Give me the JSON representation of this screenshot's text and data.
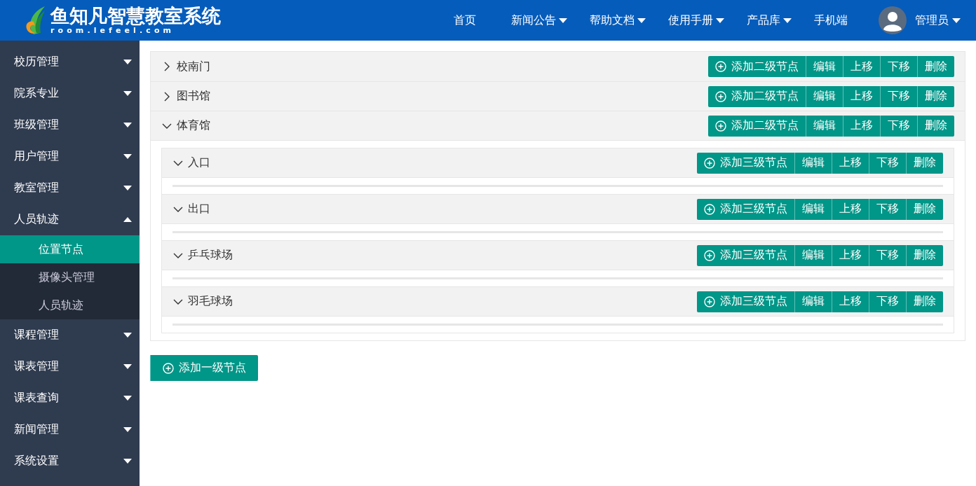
{
  "header": {
    "logo_title": "鱼知凡智慧教室系统",
    "logo_subtitle": "room.lefeel.com",
    "nav": [
      {
        "label": "首页",
        "has_menu": false
      },
      {
        "label": "新闻公告",
        "has_menu": true
      },
      {
        "label": "帮助文档",
        "has_menu": true
      },
      {
        "label": "使用手册",
        "has_menu": true
      },
      {
        "label": "产品库",
        "has_menu": true
      },
      {
        "label": "手机端",
        "has_menu": false
      }
    ],
    "user": {
      "name": "管理员",
      "has_menu": true
    }
  },
  "sidebar": {
    "items": [
      {
        "label": "校历管理",
        "expanded": false
      },
      {
        "label": "院系专业",
        "expanded": false
      },
      {
        "label": "班级管理",
        "expanded": false
      },
      {
        "label": "用户管理",
        "expanded": false
      },
      {
        "label": "教室管理",
        "expanded": false
      },
      {
        "label": "人员轨迹",
        "expanded": true,
        "children": [
          {
            "label": "位置节点",
            "selected": true
          },
          {
            "label": "摄像头管理",
            "selected": false
          },
          {
            "label": "人员轨迹",
            "selected": false
          }
        ]
      },
      {
        "label": "课程管理",
        "expanded": false
      },
      {
        "label": "课表管理",
        "expanded": false
      },
      {
        "label": "课表查询",
        "expanded": false
      },
      {
        "label": "新闻管理",
        "expanded": false
      },
      {
        "label": "系统设置",
        "expanded": false
      }
    ]
  },
  "tree": {
    "nodes": [
      {
        "name": "校南门",
        "expanded": false,
        "add_label": "添加二级节点",
        "actions": [
          "编辑",
          "上移",
          "下移",
          "删除"
        ]
      },
      {
        "name": "图书馆",
        "expanded": false,
        "add_label": "添加二级节点",
        "actions": [
          "编辑",
          "上移",
          "下移",
          "删除"
        ]
      },
      {
        "name": "体育馆",
        "expanded": true,
        "add_label": "添加二级节点",
        "actions": [
          "编辑",
          "上移",
          "下移",
          "删除"
        ],
        "children": [
          {
            "name": "入口",
            "expanded": true,
            "add_label": "添加三级节点",
            "actions": [
              "编辑",
              "上移",
              "下移",
              "删除"
            ]
          },
          {
            "name": "出口",
            "expanded": true,
            "add_label": "添加三级节点",
            "actions": [
              "编辑",
              "上移",
              "下移",
              "删除"
            ]
          },
          {
            "name": "乒乓球场",
            "expanded": true,
            "add_label": "添加三级节点",
            "actions": [
              "编辑",
              "上移",
              "下移",
              "删除"
            ]
          },
          {
            "name": "羽毛球场",
            "expanded": true,
            "add_label": "添加三级节点",
            "actions": [
              "编辑",
              "上移",
              "下移",
              "删除"
            ]
          }
        ]
      }
    ]
  },
  "add_root_button": "添加一级节点"
}
